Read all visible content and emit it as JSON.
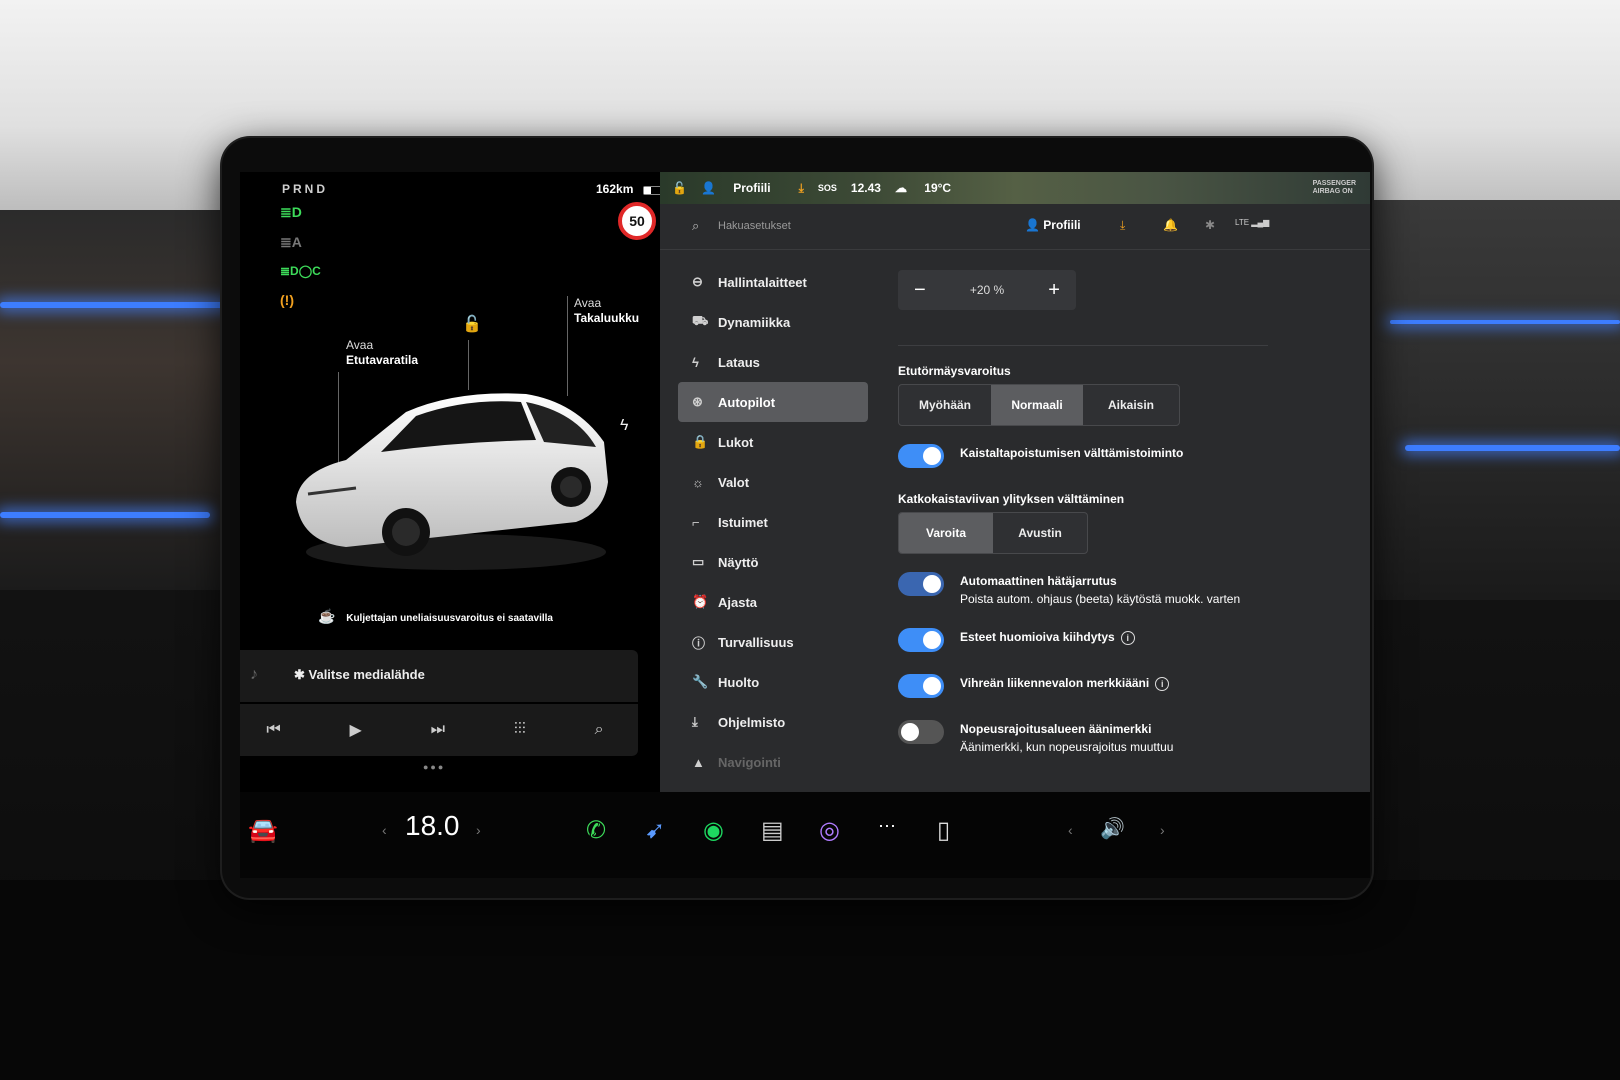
{
  "car": {
    "gear": "PRND",
    "range": "162km",
    "speed_limit": "50",
    "frunk_line1": "Avaa",
    "frunk_line2": "Etutavaratila",
    "trunk_line1": "Avaa",
    "trunk_line2": "Takaluukku",
    "driver_warning": "Kuljettajan uneliaisuusvaroitus ei saatavilla"
  },
  "media": {
    "source_label": "Valitse medialähde"
  },
  "status_bar": {
    "profile": "Profiili",
    "sos": "SOS",
    "time": "12.43",
    "outside_temp": "19°C",
    "airbag_line1": "PASSENGER",
    "airbag_line2": "AIRBAG ON"
  },
  "header": {
    "search_placeholder": "Hakuasetukset",
    "profile": "Profiili",
    "lte": "LTE"
  },
  "menu": [
    {
      "label": "Hallintalaitteet",
      "icon": "toggle-icon"
    },
    {
      "label": "Dynamiikka",
      "icon": "car-icon"
    },
    {
      "label": "Lataus",
      "icon": "bolt-icon"
    },
    {
      "label": "Autopilot",
      "icon": "steering-wheel-icon",
      "active": true
    },
    {
      "label": "Lukot",
      "icon": "lock-icon"
    },
    {
      "label": "Valot",
      "icon": "sun-icon"
    },
    {
      "label": "Istuimet",
      "icon": "seat-icon"
    },
    {
      "label": "Näyttö",
      "icon": "display-icon"
    },
    {
      "label": "Ajasta",
      "icon": "alarm-clock-icon"
    },
    {
      "label": "Turvallisuus",
      "icon": "warning-icon"
    },
    {
      "label": "Huolto",
      "icon": "wrench-icon"
    },
    {
      "label": "Ohjelmisto",
      "icon": "download-icon"
    },
    {
      "label": "Navigointi",
      "icon": "navigation-icon"
    }
  ],
  "autopilot": {
    "offset_value": "+20 %",
    "fcw_label": "Etutörmäysvaroitus",
    "fcw_options": [
      "Myöhään",
      "Normaali",
      "Aikaisin"
    ],
    "fcw_selected": "Normaali",
    "lane_departure_label": "Kaistaltapoistumisen välttämistoiminto",
    "lane_departure_on": true,
    "solid_line_label": "Katkokaistaviivan ylityksen välttäminen",
    "solid_line_options": [
      "Varoita",
      "Avustin"
    ],
    "solid_line_selected": "Varoita",
    "aeb_label": "Automaattinen hätäjarrutus",
    "aeb_sub": "Poista autom. ohjaus (beeta) käytöstä muokk. varten",
    "aeb_on": true,
    "obstacle_label": "Esteet huomioiva kiihdytys",
    "obstacle_on": true,
    "green_light_label": "Vihreän liikennevalon merkkiääni",
    "green_light_on": true,
    "speed_zone_label": "Nopeusrajoitusalueen äänimerkki",
    "speed_zone_sub": "Äänimerkki, kun nopeusrajoitus muuttuu",
    "speed_zone_on": false
  },
  "dock": {
    "temperature": "18.0"
  },
  "colors": {
    "accent": "#3e8ef7",
    "ambient": "#3d7dff",
    "speed_ring": "#e02828",
    "warning": "#f0a020"
  }
}
